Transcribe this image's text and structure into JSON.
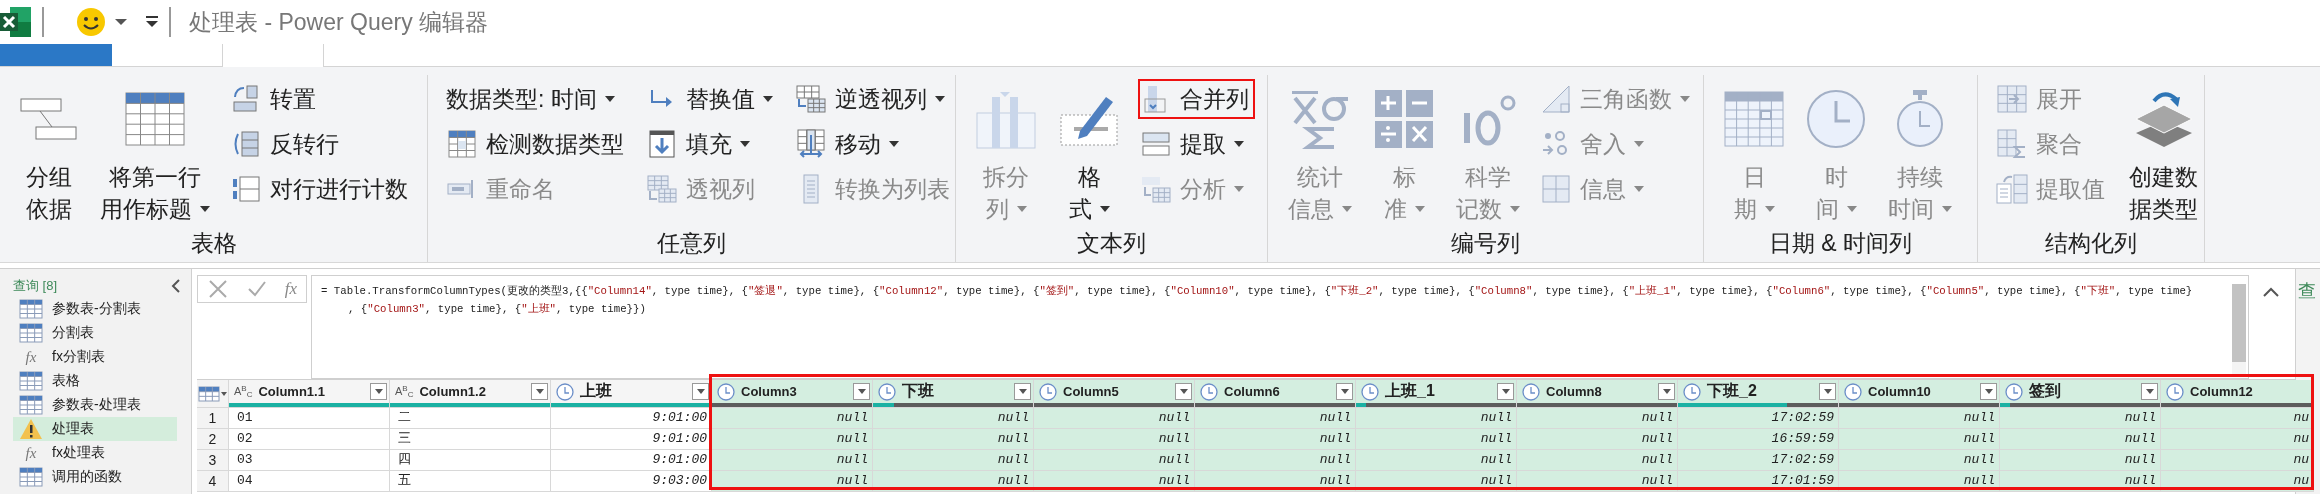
{
  "window": {
    "title": "处理表 - Power Query 编辑器"
  },
  "tabs": [
    {
      "selected": false,
      "kind": "file"
    },
    {
      "selected": false,
      "kind": "tab"
    },
    {
      "selected": true,
      "kind": "tab"
    },
    {
      "selected": false,
      "kind": "tab"
    },
    {
      "selected": false,
      "kind": "tab"
    }
  ],
  "ribbon": {
    "groups": [
      {
        "label": "表格",
        "parts": [
          {
            "kind": "large",
            "lines": [
              "分组",
              "依据"
            ],
            "dropdown": false,
            "disabled": false
          },
          {
            "kind": "large",
            "lines": [
              "将第一行",
              "用作标题"
            ],
            "dropdown": true,
            "disabled": false
          },
          {
            "kind": "stack",
            "items": [
              {
                "label": "转置",
                "dropdown": false,
                "disabled": false,
                "highlighted": false
              },
              {
                "label": "反转行",
                "dropdown": false,
                "disabled": false,
                "highlighted": false
              },
              {
                "label": "对行进行计数",
                "dropdown": false,
                "disabled": false,
                "highlighted": false
              }
            ]
          }
        ]
      },
      {
        "label": "任意列",
        "parts": [
          {
            "kind": "stack",
            "items": [
              {
                "label": "数据类型: 时间",
                "dropdown": true,
                "disabled": false,
                "highlighted": false,
                "kind": "noicon"
              },
              {
                "label": "检测数据类型",
                "dropdown": false,
                "disabled": false,
                "highlighted": false
              },
              {
                "label": "重命名",
                "dropdown": false,
                "disabled": true,
                "highlighted": false
              }
            ]
          },
          {
            "kind": "stack",
            "items": [
              {
                "label": "替换值",
                "dropdown": true,
                "disabled": false,
                "highlighted": false
              },
              {
                "label": "填充",
                "dropdown": true,
                "disabled": false,
                "highlighted": false
              },
              {
                "label": "透视列",
                "dropdown": false,
                "disabled": true,
                "highlighted": false
              }
            ]
          },
          {
            "kind": "stack",
            "items": [
              {
                "label": "逆透视列",
                "dropdown": true,
                "disabled": false,
                "highlighted": false
              },
              {
                "label": "移动",
                "dropdown": true,
                "disabled": false,
                "highlighted": false
              },
              {
                "label": "转换为列表",
                "dropdown": false,
                "disabled": true,
                "highlighted": false
              }
            ]
          }
        ]
      },
      {
        "label": "文本列",
        "parts": [
          {
            "kind": "large",
            "lines": [
              "拆分",
              "列"
            ],
            "dropdown": true,
            "disabled": true
          },
          {
            "kind": "large",
            "lines": [
              "格",
              "式"
            ],
            "dropdown": true,
            "disabled": false
          },
          {
            "kind": "stack",
            "items": [
              {
                "label": "合并列",
                "dropdown": false,
                "disabled": false,
                "highlighted": true
              },
              {
                "label": "提取",
                "dropdown": true,
                "disabled": false,
                "highlighted": false
              },
              {
                "label": "分析",
                "dropdown": true,
                "disabled": true,
                "highlighted": false
              }
            ]
          }
        ]
      },
      {
        "label": "编号列",
        "parts": [
          {
            "kind": "large",
            "lines": [
              "统计",
              "信息"
            ],
            "dropdown": true,
            "disabled": true
          },
          {
            "kind": "large",
            "lines": [
              "标",
              "准"
            ],
            "dropdown": true,
            "disabled": true
          },
          {
            "kind": "large",
            "lines": [
              "科学",
              "记数"
            ],
            "dropdown": true,
            "disabled": true
          },
          {
            "kind": "stack",
            "items": [
              {
                "label": "三角函数",
                "dropdown": true,
                "disabled": true,
                "highlighted": false
              },
              {
                "label": "舍入",
                "dropdown": true,
                "disabled": true,
                "highlighted": false
              },
              {
                "label": "信息",
                "dropdown": true,
                "disabled": true,
                "highlighted": false
              }
            ]
          }
        ]
      },
      {
        "label": "日期 & 时间列",
        "parts": [
          {
            "kind": "large",
            "lines": [
              "日",
              "期"
            ],
            "dropdown": true,
            "disabled": true
          },
          {
            "kind": "large",
            "lines": [
              "时",
              "间"
            ],
            "dropdown": true,
            "disabled": true
          },
          {
            "kind": "large",
            "lines": [
              "持续",
              "时间"
            ],
            "dropdown": true,
            "disabled": true
          }
        ]
      },
      {
        "label": "结构化列",
        "parts": [
          {
            "kind": "stack",
            "items": [
              {
                "label": "展开",
                "dropdown": false,
                "disabled": true,
                "highlighted": false
              },
              {
                "label": "聚合",
                "dropdown": false,
                "disabled": true,
                "highlighted": false
              },
              {
                "label": "提取值",
                "dropdown": false,
                "disabled": true,
                "highlighted": false
              }
            ]
          },
          {
            "kind": "large",
            "lines": [
              "创建数",
              "据类型"
            ],
            "dropdown": false,
            "disabled": false
          }
        ]
      }
    ]
  },
  "queries": {
    "title": "查询 [8]",
    "items": [
      {
        "label": "参数表-分割表",
        "kind": "table",
        "selected": false
      },
      {
        "label": "分割表",
        "kind": "table",
        "selected": false
      },
      {
        "label": "fx分割表",
        "kind": "function",
        "icon_text": "fx",
        "selected": false
      },
      {
        "label": "表格",
        "kind": "table",
        "selected": false
      },
      {
        "label": "参数表-处理表",
        "kind": "table",
        "selected": false
      },
      {
        "label": "处理表",
        "kind": "warning",
        "selected": true
      },
      {
        "label": "fx处理表",
        "kind": "function",
        "icon_text": "fx",
        "selected": false
      },
      {
        "label": "调用的函数",
        "kind": "table",
        "selected": false
      }
    ]
  },
  "formula_bar": {
    "fx_label": "fx",
    "lines": [
      "= Table.TransformColumnTypes(更改的类型3,{{\"Column14\", type time}, {\"签退\", type time}, {\"Column12\", type time}, {\"签到\", type time}, {\"Column10\", type time}, {\"下班_2\", type time}, {\"Column8\", type time}, {\"上班_1\", type time}, {\"Column6\", type time}, {\"Column5\", type time}, {\"下班\", type time}",
      ", {\"Column3\", type time}, {\"上班\", type time}})"
    ]
  },
  "grid": {
    "selection_framed": true,
    "columns": [
      {
        "name": "Column1.1",
        "kind": "text",
        "type_icon": "A$^{B}$$_{C}$",
        "selected": false,
        "level": 1
      },
      {
        "name": "Column1.2",
        "kind": "text",
        "type_icon": "A$^{B}$$_{C}$",
        "selected": false,
        "level": 1
      },
      {
        "name": "上班",
        "kind": "time",
        "selected": false,
        "level": 1
      },
      {
        "name": "Column3",
        "kind": "time",
        "selected": true,
        "level": 0
      },
      {
        "name": "下班",
        "kind": "time",
        "selected": true,
        "level": 0.13
      },
      {
        "name": "Column5",
        "kind": "time",
        "selected": true,
        "level": 0
      },
      {
        "name": "Column6",
        "kind": "time",
        "selected": true,
        "level": 0
      },
      {
        "name": "上班_1",
        "kind": "time",
        "selected": true,
        "level": 0.06
      },
      {
        "name": "Column8",
        "kind": "time",
        "selected": true,
        "level": 0
      },
      {
        "name": "下班_2",
        "kind": "time",
        "selected": true,
        "level": 0.68
      },
      {
        "name": "Column10",
        "kind": "time",
        "selected": true,
        "level": 0
      },
      {
        "name": "签到",
        "kind": "time",
        "selected": true,
        "level": 0.06
      },
      {
        "name": "Column12",
        "kind": "time",
        "selected": true,
        "level": 0
      }
    ],
    "rows": [
      {
        "number": "1",
        "cells": [
          "01",
          "二",
          "9:01:00",
          "null",
          "null",
          "null",
          "null",
          "null",
          "null",
          "17:02:59",
          "null",
          "null",
          "nu"
        ]
      },
      {
        "number": "2",
        "cells": [
          "02",
          "三",
          "9:01:00",
          "null",
          "null",
          "null",
          "null",
          "null",
          "null",
          "16:59:59",
          "null",
          "null",
          "nu"
        ]
      },
      {
        "number": "3",
        "cells": [
          "03",
          "四",
          "9:01:00",
          "null",
          "null",
          "null",
          "null",
          "null",
          "null",
          "17:02:59",
          "null",
          "null",
          "nu"
        ]
      },
      {
        "number": "4",
        "cells": [
          "04",
          "五",
          "9:03:00",
          "null",
          "null",
          "null",
          "null",
          "null",
          "null",
          "17:01:59",
          "null",
          "null",
          "nu"
        ]
      }
    ]
  },
  "properties_panel": {
    "title": "查"
  }
}
